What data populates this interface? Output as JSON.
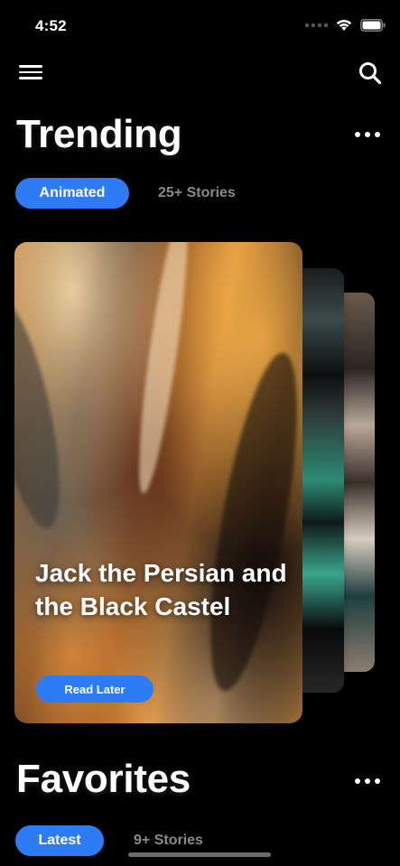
{
  "status_bar": {
    "time": "4:52"
  },
  "nav": {
    "menu_icon": "hamburger-menu-icon",
    "search_icon": "search-icon"
  },
  "trending": {
    "title": "Trending",
    "filter_label": "Animated",
    "count_label": "25+ Stories",
    "card": {
      "title": "Jack the Persian and the Black Castel",
      "button_label": "Read Later"
    }
  },
  "favorites": {
    "title": "Favorites",
    "filter_label": "Latest",
    "count_label": "9+ Stories"
  },
  "colors": {
    "accent": "#2d7cf6",
    "background": "#000000",
    "muted_text": "#8a8a8a"
  }
}
